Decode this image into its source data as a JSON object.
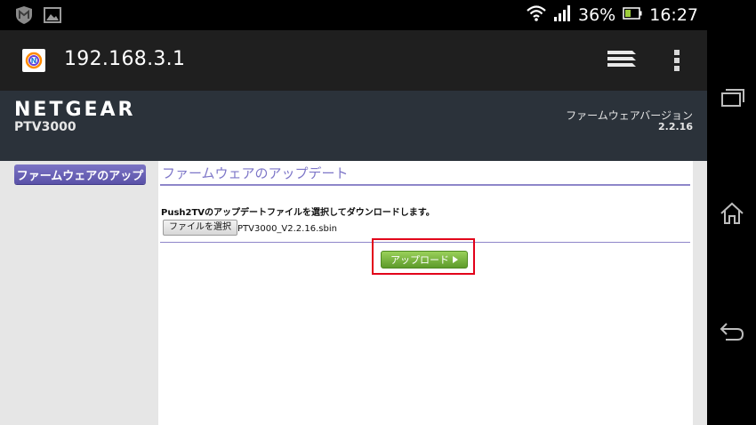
{
  "status_bar": {
    "battery": "36%",
    "time": "16:27",
    "icons": [
      "mcafee-icon",
      "gallery-icon",
      "wifi-icon",
      "signal-icon",
      "battery-icon"
    ]
  },
  "browser": {
    "url": "192.168.3.1",
    "icons": [
      "site-favicon",
      "tabs-icon",
      "overflow-menu-icon"
    ]
  },
  "header": {
    "brand": "NETGEAR",
    "model": "PTV3000",
    "firmware_label": "ファームウェアバージョン",
    "firmware_version": "2.2.16"
  },
  "sidebar": {
    "button_label": "ファームウェアのアップ"
  },
  "main": {
    "title": "ファームウェアのアップデート",
    "description": "Push2TVのアップデートファイルを選択してダウンロードします。",
    "choose_file_label": "ファイルを選択",
    "file_name": "PTV3000_V2.2.16.sbin",
    "upload_label": "アップロード"
  },
  "system_nav": {
    "icons": [
      "recent-apps-icon",
      "home-icon",
      "back-icon"
    ]
  },
  "colors": {
    "header_bg": "#2b323a",
    "accent_purple": "#7d76c8",
    "upload_green": "#6fae38",
    "highlight_red": "#e2001a"
  }
}
